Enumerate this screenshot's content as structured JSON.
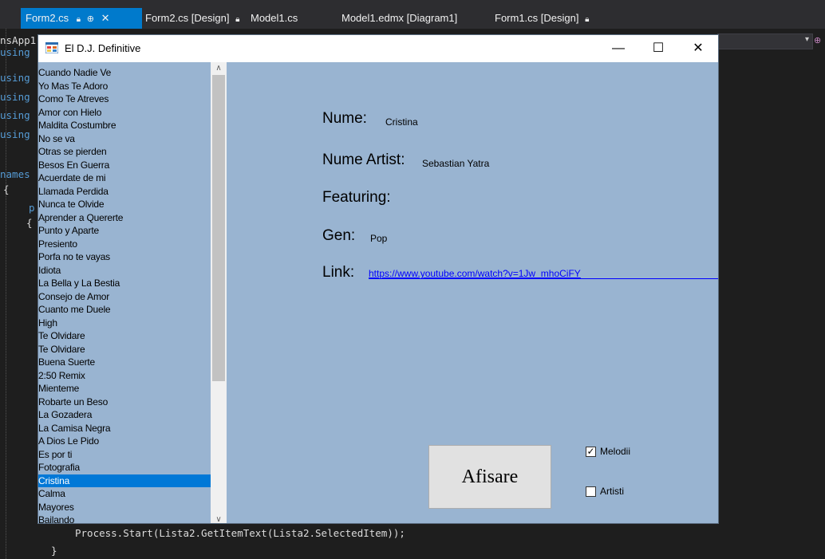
{
  "ide": {
    "tabs": [
      {
        "label": "Form2.cs",
        "pin": "⊕",
        "close": "✕"
      },
      {
        "label": "Form2.cs [Design]"
      },
      {
        "label": "Model1.cs"
      },
      {
        "label": "Model1.edmx [Diagram1]"
      },
      {
        "label": "Form1.cs [Design]"
      }
    ],
    "code_left": [
      "nsApp1",
      "using",
      "using",
      "using",
      "using",
      "using",
      "names",
      "{",
      "p",
      "{"
    ],
    "code_bottom": "Process.Start(Lista2.GetItemText(Lista2.SelectedItem));",
    "code_brace": "}",
    "colors": {
      "accent": "#007acc",
      "editor_bg": "#1e1e1e",
      "keyword": "#569cd6"
    }
  },
  "window": {
    "title": "El D.J. Definitive",
    "minimize": "—",
    "maximize": "☐",
    "close": "✕",
    "bg_color": "#99b4d1"
  },
  "songs": {
    "items": [
      "Cuando Nadie Ve",
      "Yo Mas Te Adoro",
      "Como Te Atreves",
      "Amor con Hielo",
      "Maldita Costumbre",
      "No se va",
      "Otras se pierden",
      "Besos En Guerra",
      "Acuerdate de mi",
      "Llamada Perdida",
      "Nunca te Olvide",
      "Aprender a Quererte",
      "Punto y Aparte",
      "Presiento",
      "Porfa no te vayas",
      "Idiota",
      "La Bella y La Bestia",
      "Consejo de Amor",
      "Cuanto me Duele",
      "High",
      "Te Olvidare",
      "Te Olvidare",
      "Buena Suerte",
      "2:50 Remix",
      "Mienteme",
      "Robarte un Beso",
      "La Gozadera",
      "La Camisa Negra",
      "A Dios Le Pido",
      "Es por ti",
      "Fotografia",
      "Cristina",
      "Calma",
      "Mayores",
      "Bailando"
    ],
    "selected_index": 31,
    "scroll_up": "∧",
    "scroll_down": "∨"
  },
  "details": {
    "nume_label": "Nume:",
    "nume_value": "Cristina",
    "artist_label": "Nume Artist:",
    "artist_value": "Sebastian Yatra",
    "featuring_label": "Featuring:",
    "gen_label": "Gen:",
    "gen_value": "Pop",
    "link_label": "Link:",
    "link_value": "https://www.youtube.com/watch?v=1Jw_mhoCiFY"
  },
  "controls": {
    "afisare_label": "Afisare",
    "melodii_label": "Melodii",
    "melodii_checked": true,
    "artisti_label": "Artisti",
    "artisti_checked": false,
    "check_mark": "✓"
  }
}
